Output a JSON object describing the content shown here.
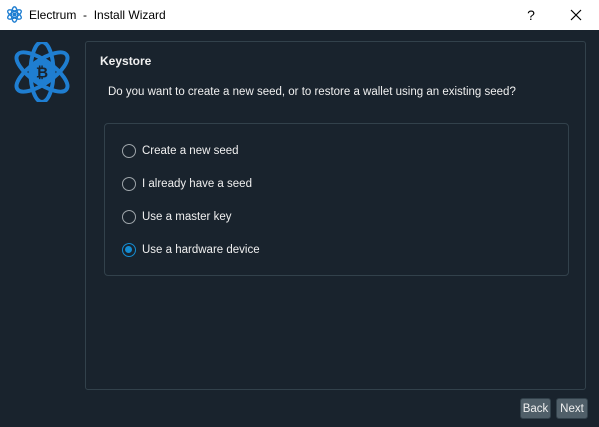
{
  "window": {
    "app_name": "Electrum",
    "separator": "-",
    "title": "Install Wizard",
    "help_label": "?",
    "close_icon": "close-icon"
  },
  "logo": {
    "icon": "electrum-bitcoin-atom-logo",
    "glyph": "₿"
  },
  "keystore": {
    "heading": "Keystore",
    "question": "Do you want to create a new seed, or to restore a wallet using an existing seed?",
    "options": [
      {
        "label": "Create a new seed",
        "selected": false
      },
      {
        "label": "I already have a seed",
        "selected": false
      },
      {
        "label": "Use a master key",
        "selected": false
      },
      {
        "label": "Use a hardware device",
        "selected": true
      }
    ]
  },
  "footer": {
    "back_label": "Back",
    "next_label": "Next"
  },
  "colors": {
    "background": "#19232d",
    "border": "#32414b",
    "text": "#f0f0f0",
    "accent": "#148cd2",
    "button": "#505f69",
    "logo_blue": "#1f7ed1"
  }
}
